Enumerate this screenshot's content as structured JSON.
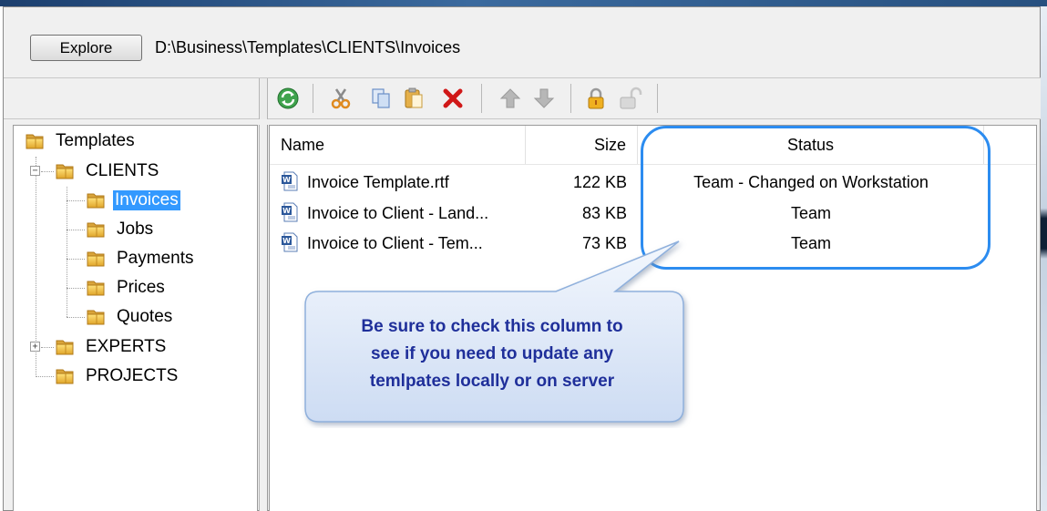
{
  "window": {
    "explore_button": "Explore",
    "path": "D:\\Business\\Templates\\CLIENTS\\Invoices"
  },
  "toolbar": {
    "icons": [
      "refresh-icon",
      "cut-icon",
      "copy-icon",
      "paste-icon",
      "delete-icon",
      "move-up-icon",
      "move-down-icon",
      "lock-icon",
      "unlock-icon"
    ]
  },
  "tree": {
    "root": "Templates",
    "clients": "CLIENTS",
    "invoices": "Invoices",
    "jobs": "Jobs",
    "payments": "Payments",
    "prices": "Prices",
    "quotes": "Quotes",
    "experts": "EXPERTS",
    "projects": "PROJECTS",
    "selected": "Invoices"
  },
  "file_list": {
    "headers": {
      "name": "Name",
      "size": "Size",
      "status": "Status"
    },
    "rows": [
      {
        "name": "Invoice Template.rtf",
        "size": "122 KB",
        "status": "Team - Changed on Workstation"
      },
      {
        "name": "Invoice to Client - Land...",
        "size": "83 KB",
        "status": "Team"
      },
      {
        "name": "Invoice to Client - Tem...",
        "size": "73 KB",
        "status": "Team"
      }
    ]
  },
  "callout": {
    "line1": "Be sure to check this column to",
    "line2": "see if you need to update any",
    "line3": "temlpates locally or on server"
  },
  "colors": {
    "selection": "#3399ff",
    "highlight_border": "#2c8cf0",
    "callout_text": "#1f2f9a",
    "callout_fill": "#dce8fa"
  }
}
